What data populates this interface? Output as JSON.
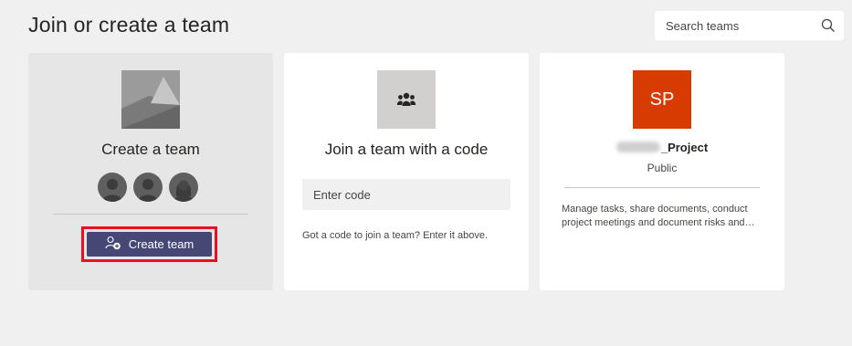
{
  "header": {
    "title": "Join or create a team"
  },
  "search": {
    "placeholder": "Search teams"
  },
  "create_card": {
    "title": "Create a team",
    "button_label": "Create team"
  },
  "join_card": {
    "title": "Join a team with a code",
    "input_placeholder": "Enter code",
    "hint": "Got a code to join a team? Enter it above."
  },
  "team_card": {
    "initials": "SP",
    "name_suffix": "_Project",
    "privacy": "Public",
    "description": "Manage tasks, share documents, conduct project meetings and document risks and issues",
    "color": "#d83b01"
  },
  "colors": {
    "accent": "#464775",
    "highlight_border": "#e81123",
    "background": "#f0f0f0"
  }
}
